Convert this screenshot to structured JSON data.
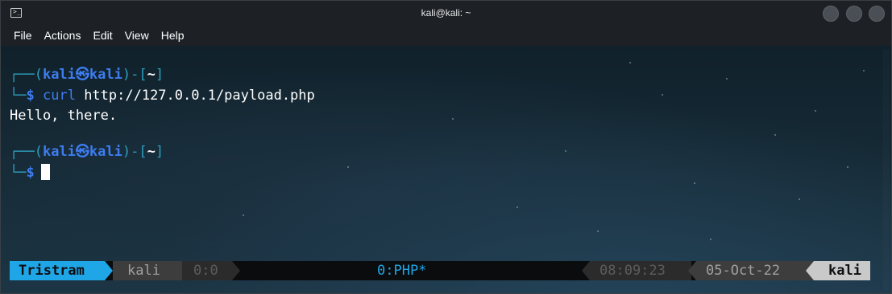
{
  "window": {
    "title": "kali@kali: ~",
    "menu": [
      "File",
      "Actions",
      "Edit",
      "View",
      "Help"
    ]
  },
  "terminal": {
    "prompt1": {
      "user": "kali",
      "host": "kali",
      "dir": "~",
      "command": "curl",
      "argument": "http://127.0.0.1/payload.php"
    },
    "output": "Hello, there.",
    "prompt2": {
      "user": "kali",
      "host": "kali",
      "dir": "~"
    }
  },
  "statusbar": {
    "session": "Tristram",
    "user": "kali",
    "pane": "0:0",
    "window": "0:PHP*",
    "time": "08:09:23",
    "date": "05-Oct-22",
    "host": "kali",
    "colors": {
      "session_bg": "#1fa6e6",
      "window_fg": "#1fa6e6"
    }
  },
  "colors": {
    "prompt_blue": "#3d7df0",
    "box_cyan": "#2e9fbd"
  }
}
